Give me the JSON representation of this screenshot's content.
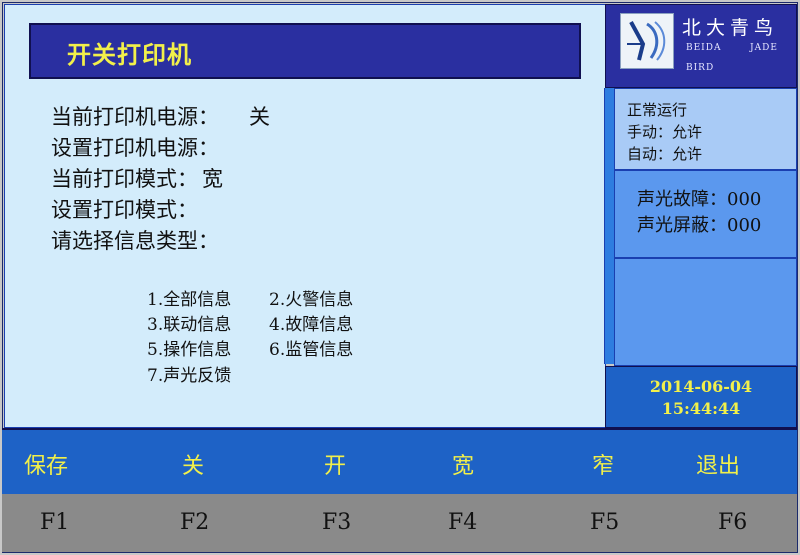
{
  "title": "开关打印机",
  "info": {
    "current_power_label": "当前打印机电源：",
    "current_power_value": "关",
    "set_power_label": "设置打印机电源：",
    "current_mode_label": "当前打印模式：",
    "current_mode_value": "宽",
    "set_mode_label": "设置打印模式：",
    "select_type_label": "请选择信息类型："
  },
  "options": [
    "1.全部信息",
    "2.火警信息",
    "3.联动信息",
    "4.故障信息",
    "5.操作信息",
    "6.监管信息",
    "7.声光反馈"
  ],
  "logo": {
    "name": "北大青鸟",
    "en_left": "BEIDA",
    "en_right": "JADE",
    "en_bottom": "BIRD",
    "icon": "bird-logo-icon"
  },
  "status": {
    "line1": "正常运行",
    "line2": "手动：允许",
    "line3": "自动：允许"
  },
  "fault": {
    "sound_light_fault": "声光故障：000",
    "sound_light_mask": "声光屏蔽：000"
  },
  "datetime": {
    "date": "2014-06-04",
    "time": "15:44:44"
  },
  "function_keys": [
    {
      "label": "保存",
      "key": "F1"
    },
    {
      "label": "关",
      "key": "F2"
    },
    {
      "label": "开",
      "key": "F3"
    },
    {
      "label": "宽",
      "key": "F4"
    },
    {
      "label": "窄",
      "key": "F5"
    },
    {
      "label": "退出",
      "key": "F6"
    }
  ],
  "colors": {
    "title_bg": "#2a2fa0",
    "title_text": "#f2f04a",
    "panel_bg": "#d3ecfb",
    "key_bar": "#1e62c6",
    "key_text": "#f2f04a",
    "fnum_bar": "#8a8a8a"
  }
}
